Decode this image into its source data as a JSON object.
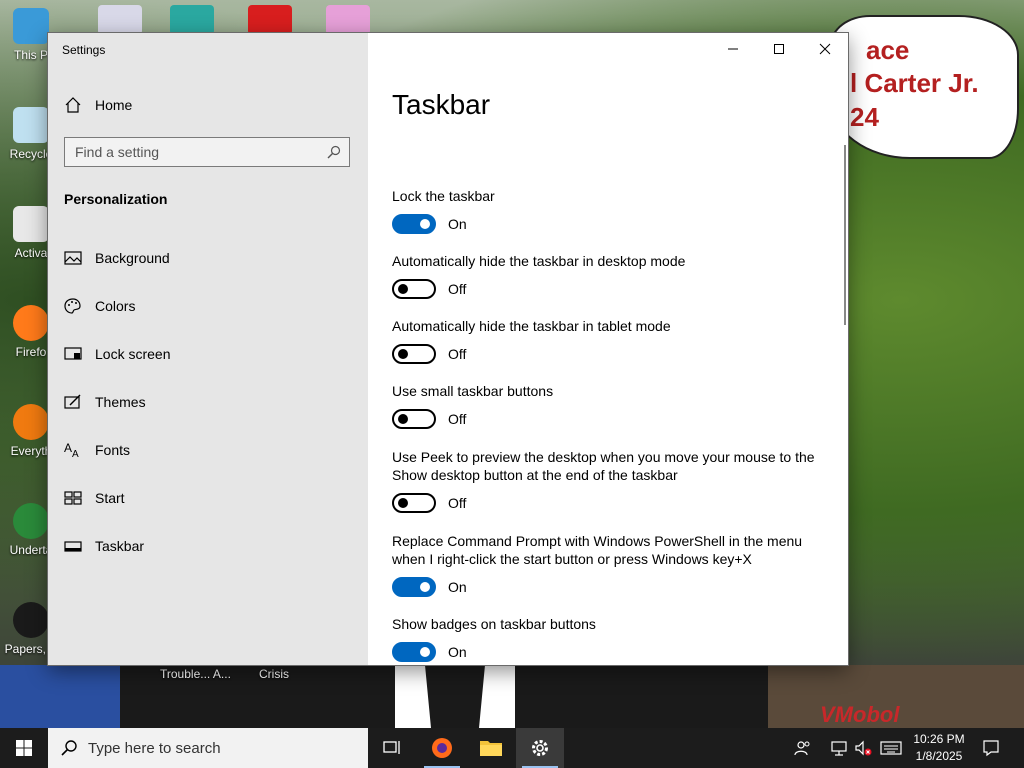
{
  "desktop": {
    "icons": [
      {
        "label": "This P"
      },
      {
        "label": "Recycle"
      },
      {
        "label": "Activa"
      },
      {
        "label": "Firefo"
      },
      {
        "label": "Everyth"
      },
      {
        "label": "Underta"
      },
      {
        "label": "Papers, P"
      }
    ],
    "bottom_labels": [
      "Trouble... A...",
      "Crisis"
    ],
    "bubble_lines": [
      "ace",
      "l Carter Jr.",
      "24"
    ],
    "watermark": "VMobol"
  },
  "window": {
    "title": "Settings",
    "controls": {
      "minimize": "minimize",
      "maximize": "maximize",
      "close": "close"
    }
  },
  "sidebar": {
    "home": "Home",
    "search_placeholder": "Find a setting",
    "section": "Personalization",
    "items": [
      {
        "label": "Background",
        "icon": "picture-icon"
      },
      {
        "label": "Colors",
        "icon": "palette-icon"
      },
      {
        "label": "Lock screen",
        "icon": "lock-screen-icon"
      },
      {
        "label": "Themes",
        "icon": "themes-icon"
      },
      {
        "label": "Fonts",
        "icon": "fonts-icon"
      },
      {
        "label": "Start",
        "icon": "start-icon"
      },
      {
        "label": "Taskbar",
        "icon": "taskbar-icon",
        "active": true
      }
    ]
  },
  "main": {
    "title": "Taskbar",
    "settings": [
      {
        "label": "Lock the taskbar",
        "state": "On"
      },
      {
        "label": "Automatically hide the taskbar in desktop mode",
        "state": "Off"
      },
      {
        "label": "Automatically hide the taskbar in tablet mode",
        "state": "Off"
      },
      {
        "label": "Use small taskbar buttons",
        "state": "Off"
      },
      {
        "label": "Use Peek to preview the desktop when you move your mouse to the Show desktop button at the end of the taskbar",
        "state": "Off"
      },
      {
        "label": "Replace Command Prompt with Windows PowerShell in the menu when I right-click the start button or press Windows key+X",
        "state": "On"
      },
      {
        "label": "Show badges on taskbar buttons",
        "state": "On"
      }
    ]
  },
  "taskbar": {
    "search_placeholder": "Type here to search",
    "time": "10:26 PM",
    "date": "1/8/2025",
    "accent": "#0067c0"
  }
}
